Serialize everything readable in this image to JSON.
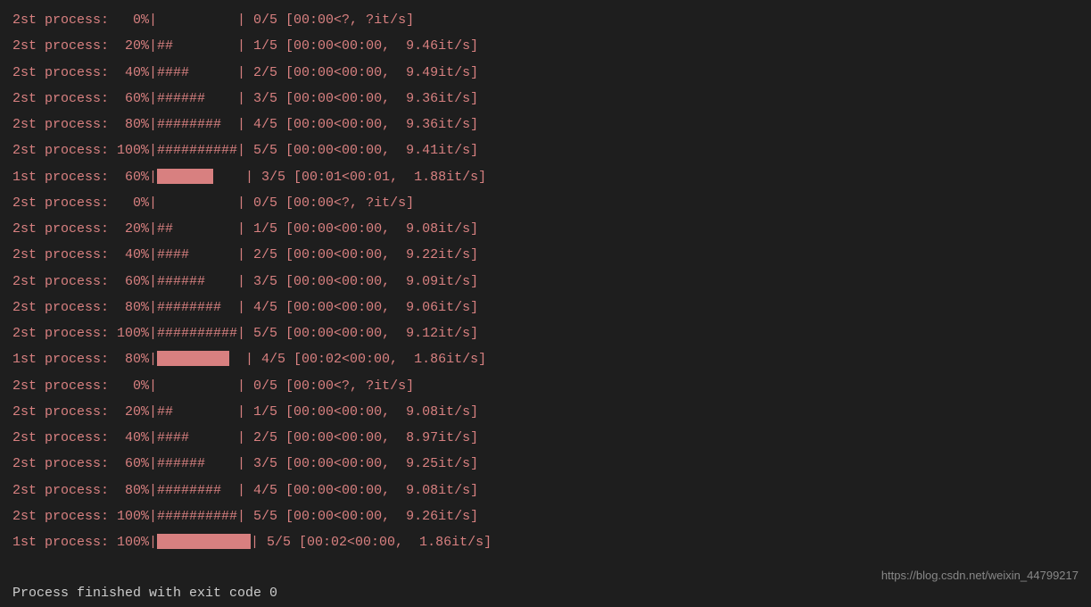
{
  "lines": [
    {
      "type": "hash",
      "label": "2st process:",
      "pct": "   0%",
      "bar": "",
      "post": "          | 0/5 [00:00<?, ?it/s]"
    },
    {
      "type": "hash",
      "label": "2st process:",
      "pct": "  20%",
      "bar": "##",
      "post": "        | 1/5 [00:00<00:00,  9.46it/s]"
    },
    {
      "type": "hash",
      "label": "2st process:",
      "pct": "  40%",
      "bar": "####",
      "post": "      | 2/5 [00:00<00:00,  9.49it/s]"
    },
    {
      "type": "hash",
      "label": "2st process:",
      "pct": "  60%",
      "bar": "######",
      "post": "    | 3/5 [00:00<00:00,  9.36it/s]"
    },
    {
      "type": "hash",
      "label": "2st process:",
      "pct": "  80%",
      "bar": "########",
      "post": "  | 4/5 [00:00<00:00,  9.36it/s]"
    },
    {
      "type": "hash",
      "label": "2st process:",
      "pct": " 100%",
      "bar": "##########",
      "post": "| 5/5 [00:00<00:00,  9.41it/s]"
    },
    {
      "type": "solid",
      "label": "1st process:",
      "pct": "  60%",
      "fill": "filled-60",
      "post": "    | 3/5 [00:01<00:01,  1.88it/s]"
    },
    {
      "type": "hash",
      "label": "2st process:",
      "pct": "   0%",
      "bar": "",
      "post": "          | 0/5 [00:00<?, ?it/s]"
    },
    {
      "type": "hash",
      "label": "2st process:",
      "pct": "  20%",
      "bar": "##",
      "post": "        | 1/5 [00:00<00:00,  9.08it/s]"
    },
    {
      "type": "hash",
      "label": "2st process:",
      "pct": "  40%",
      "bar": "####",
      "post": "      | 2/5 [00:00<00:00,  9.22it/s]"
    },
    {
      "type": "hash",
      "label": "2st process:",
      "pct": "  60%",
      "bar": "######",
      "post": "    | 3/5 [00:00<00:00,  9.09it/s]"
    },
    {
      "type": "hash",
      "label": "2st process:",
      "pct": "  80%",
      "bar": "########",
      "post": "  | 4/5 [00:00<00:00,  9.06it/s]"
    },
    {
      "type": "hash",
      "label": "2st process:",
      "pct": " 100%",
      "bar": "##########",
      "post": "| 5/5 [00:00<00:00,  9.12it/s]"
    },
    {
      "type": "solid",
      "label": "1st process:",
      "pct": "  80%",
      "fill": "filled-80",
      "post": "  | 4/5 [00:02<00:00,  1.86it/s]"
    },
    {
      "type": "hash",
      "label": "2st process:",
      "pct": "   0%",
      "bar": "",
      "post": "          | 0/5 [00:00<?, ?it/s]"
    },
    {
      "type": "hash",
      "label": "2st process:",
      "pct": "  20%",
      "bar": "##",
      "post": "        | 1/5 [00:00<00:00,  9.08it/s]"
    },
    {
      "type": "hash",
      "label": "2st process:",
      "pct": "  40%",
      "bar": "####",
      "post": "      | 2/5 [00:00<00:00,  8.97it/s]"
    },
    {
      "type": "hash",
      "label": "2st process:",
      "pct": "  60%",
      "bar": "######",
      "post": "    | 3/5 [00:00<00:00,  9.25it/s]"
    },
    {
      "type": "hash",
      "label": "2st process:",
      "pct": "  80%",
      "bar": "########",
      "post": "  | 4/5 [00:00<00:00,  9.08it/s]"
    },
    {
      "type": "hash",
      "label": "2st process:",
      "pct": " 100%",
      "bar": "##########",
      "post": "| 5/5 [00:00<00:00,  9.26it/s]"
    },
    {
      "type": "solid",
      "label": "1st process:",
      "pct": " 100%",
      "fill": "filled-100",
      "post": "| 5/5 [00:02<00:00,  1.86it/s]"
    }
  ],
  "exit_message": "Process finished with exit code 0",
  "watermark_text": "https://blog.csdn.net/weixin_44799217"
}
